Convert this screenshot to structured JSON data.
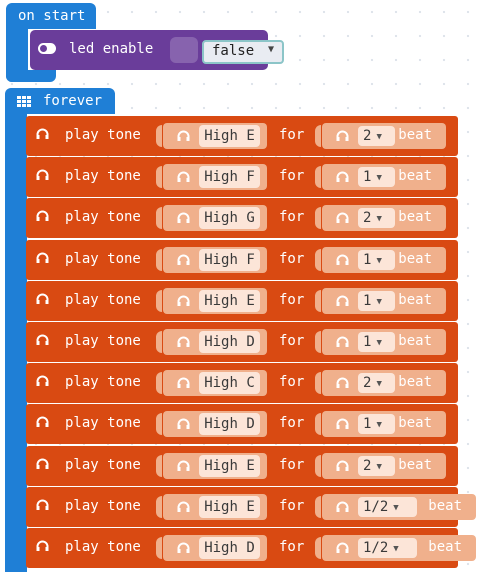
{
  "on_start": {
    "label": "on start"
  },
  "led_enable": {
    "label": "led enable",
    "value": "false"
  },
  "forever": {
    "label": "forever"
  },
  "play_tone": {
    "label": "play tone",
    "for_label": "for",
    "beat_label": "beat"
  },
  "tones": [
    {
      "note": "High E",
      "beat": "2"
    },
    {
      "note": "High F",
      "beat": "1"
    },
    {
      "note": "High G",
      "beat": "2"
    },
    {
      "note": "High F",
      "beat": "1"
    },
    {
      "note": "High E",
      "beat": "1"
    },
    {
      "note": "High D",
      "beat": "1"
    },
    {
      "note": "High C",
      "beat": "2"
    },
    {
      "note": "High D",
      "beat": "1"
    },
    {
      "note": "High E",
      "beat": "2"
    },
    {
      "note": "High E",
      "beat": "1/2"
    },
    {
      "note": "High D",
      "beat": "1/2"
    }
  ],
  "colors": {
    "event_block": "#1f7fd6",
    "led_block": "#6a3d9a",
    "music_block": "#d94a12",
    "music_slot": "#f0b08c"
  }
}
